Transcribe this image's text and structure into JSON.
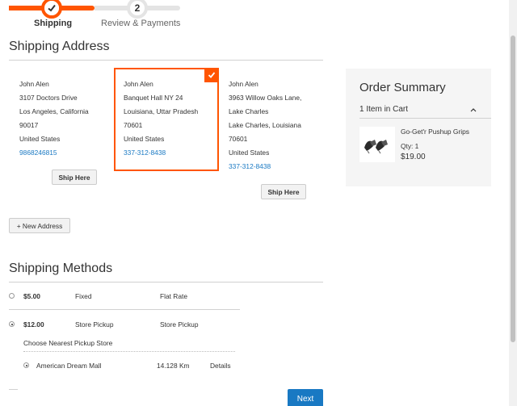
{
  "progress": {
    "steps": [
      {
        "number": "1",
        "label": "Shipping",
        "state": "active"
      },
      {
        "number": "2",
        "label": "Review & Payments",
        "state": "pending"
      }
    ],
    "accent": "#ff5501"
  },
  "shipping_address": {
    "title": "Shipping Address",
    "addresses": [
      {
        "lines": [
          "John Alen",
          "3107 Doctors Drive",
          "Los Angeles, California",
          "90017",
          "United States"
        ],
        "phone": "9868246815",
        "button": "Ship Here",
        "selected": false
      },
      {
        "lines": [
          "John Alen",
          "Banquet Hall NY 24",
          "Louisiana, Uttar Pradesh",
          "70601",
          "United States"
        ],
        "phone": "337-312-8438",
        "selected": true
      },
      {
        "lines": [
          "John Alen",
          "3963 Willow Oaks Lane,",
          "Lake Charles",
          "Lake Charles, Louisiana",
          "70601",
          "United States"
        ],
        "phone": "337-312-8438",
        "button": "Ship Here",
        "selected": false
      }
    ],
    "new_address_button": "+ New Address"
  },
  "order_summary": {
    "title": "Order Summary",
    "items_count": "1 Item in Cart",
    "item": {
      "name": "Go-Get'r Pushup Grips",
      "qty": "Qty: 1",
      "price": "$19.00"
    }
  },
  "shipping_methods": {
    "title": "Shipping Methods",
    "rows": [
      {
        "price": "$5.00",
        "method": "Fixed",
        "carrier": "Flat Rate",
        "checked": false
      },
      {
        "price": "$12.00",
        "method": "Store Pickup",
        "carrier": "Store Pickup",
        "checked": true
      }
    ],
    "pickup_label": "Choose Nearest Pickup Store",
    "store": {
      "name": "American Dream Mall",
      "distance": "14.128 Km",
      "details": "Details",
      "checked": true
    }
  },
  "next_button": "Next",
  "colors": {
    "accent": "#ff5501",
    "link": "#1979c3",
    "primary_button": "#1979c3"
  }
}
